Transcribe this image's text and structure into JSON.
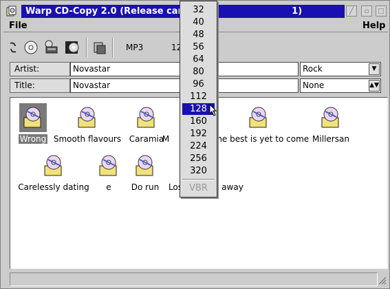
{
  "window": {
    "title": "Warp CD-Copy 2.0 (Release candidate 1)",
    "title_visible": "Warp CD-Copy 2.0 (Release candi",
    "title_tail": "1)",
    "accent": "#1a0fb0"
  },
  "menubar": {
    "file": "File",
    "help": "Help"
  },
  "toolbar": {
    "format_label": "MP3",
    "bitrate_partial": "12"
  },
  "fields": {
    "artist_label": "Artist:",
    "artist_value": "Novastar",
    "title_label": "Title:",
    "title_value": "Novastar",
    "genre_value": "Rock",
    "second_combo_value": "None"
  },
  "tracks": [
    {
      "name": "Wrong",
      "selected": true
    },
    {
      "name": "Smooth flavours",
      "selected": false
    },
    {
      "name": "Caramia",
      "selected": false
    },
    {
      "name": "M",
      "selected": false
    },
    {
      "name": "The best is yet to come",
      "selected": false
    },
    {
      "name": "Millersan",
      "selected": false
    },
    {
      "name": "Carelessly dating",
      "selected": false
    },
    {
      "name": "e",
      "selected": false
    },
    {
      "name": "Do run",
      "selected": false
    },
    {
      "name": "Los",
      "selected": false
    },
    {
      "name": "away",
      "selected": false
    }
  ],
  "bitrate_dropdown": {
    "items": [
      "32",
      "40",
      "48",
      "56",
      "64",
      "80",
      "96",
      "112",
      "128",
      "160",
      "192",
      "224",
      "256",
      "320"
    ],
    "selected": "128",
    "disabled_item": "VBR"
  }
}
